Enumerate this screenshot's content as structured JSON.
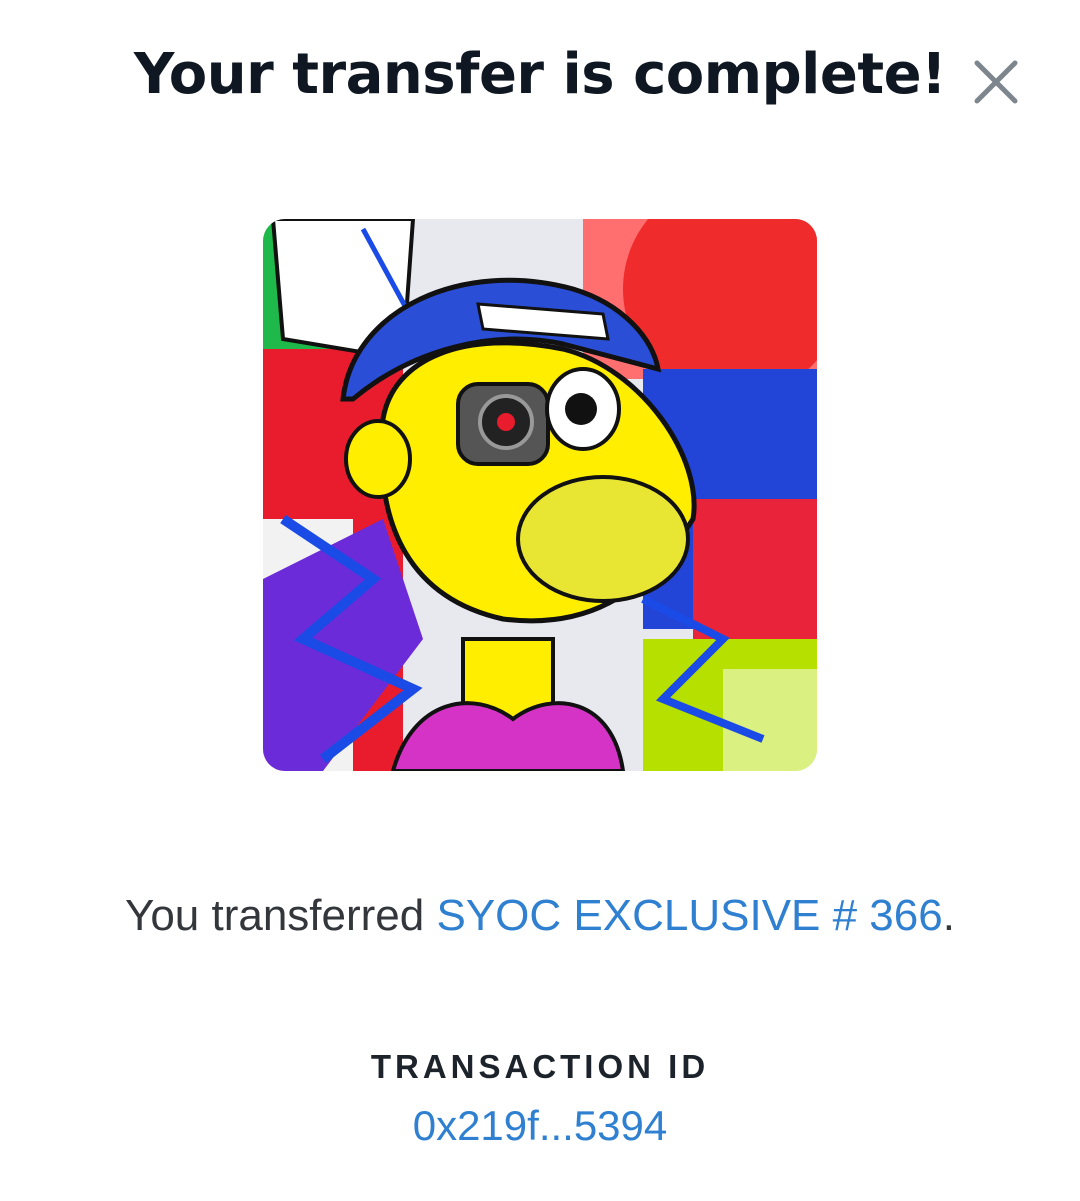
{
  "dialog": {
    "title": "Your transfer is complete!",
    "close_icon": "close-icon"
  },
  "message": {
    "prefix": "You transferred ",
    "nft_name": "SYOC EXCLUSIVE # 366",
    "suffix": "."
  },
  "transaction": {
    "label": "TRANSACTION ID",
    "id": "0x219f...5394"
  },
  "colors": {
    "title": "#0f1722",
    "link": "#2f80d1",
    "close_icon": "#7d858d"
  }
}
